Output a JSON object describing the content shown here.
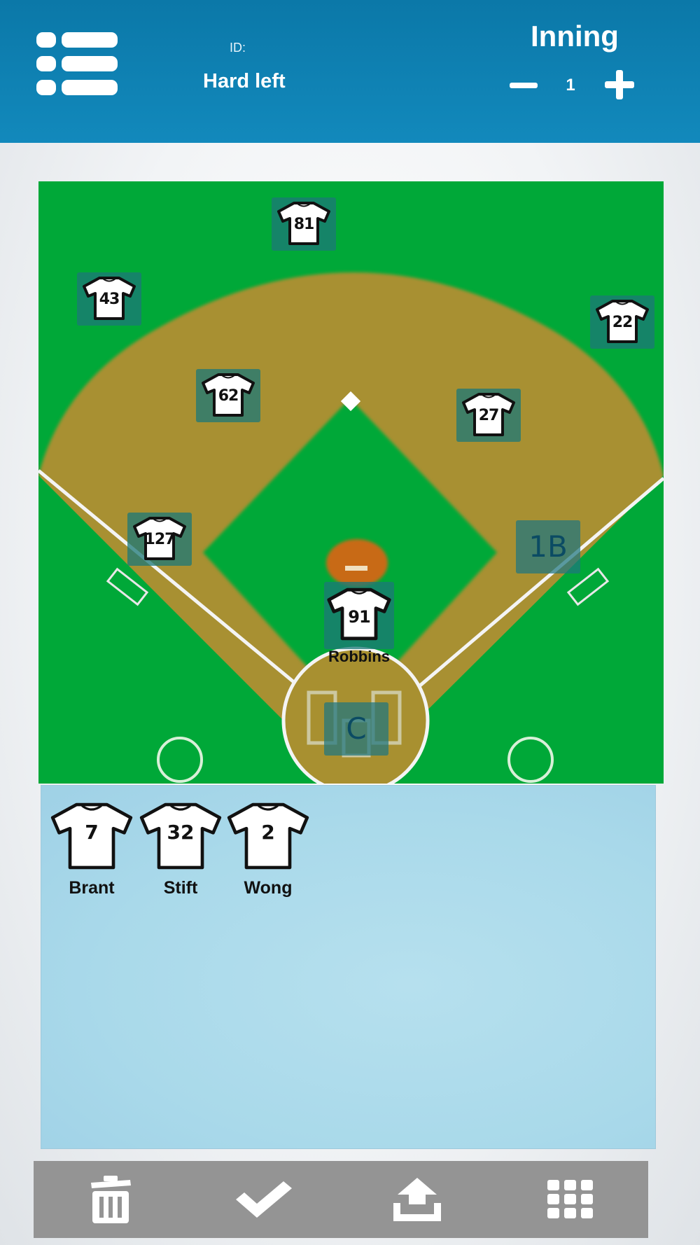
{
  "header": {
    "id_label": "ID:",
    "id_value": "Hard left",
    "inning_label": "Inning",
    "inning_value": "1",
    "icons": [
      "menu-icon",
      "minus-icon",
      "plus-icon"
    ]
  },
  "field": {
    "players": [
      {
        "number": "81",
        "name": ""
      },
      {
        "number": "43",
        "name": ""
      },
      {
        "number": "22",
        "name": ""
      },
      {
        "number": "62",
        "name": ""
      },
      {
        "number": "27",
        "name": ""
      },
      {
        "number": "127",
        "name": ""
      },
      {
        "number": "91",
        "name": "Robbins"
      }
    ],
    "positions": [
      {
        "label": "1B"
      },
      {
        "label": "C"
      }
    ]
  },
  "bench": {
    "players": [
      {
        "number": "7",
        "name": "Brant"
      },
      {
        "number": "32",
        "name": "Stift"
      },
      {
        "number": "2",
        "name": "Wong"
      }
    ]
  },
  "toolbar": {
    "icons": [
      "trash-icon",
      "check-icon",
      "upload-icon",
      "grid-icon"
    ]
  },
  "colors": {
    "header": "#0b78a8",
    "grass": "#00a838",
    "dirt": "#a89030",
    "position_tile": "#1c7878",
    "bench": "#acdaeb",
    "toolbar": "#949494"
  }
}
